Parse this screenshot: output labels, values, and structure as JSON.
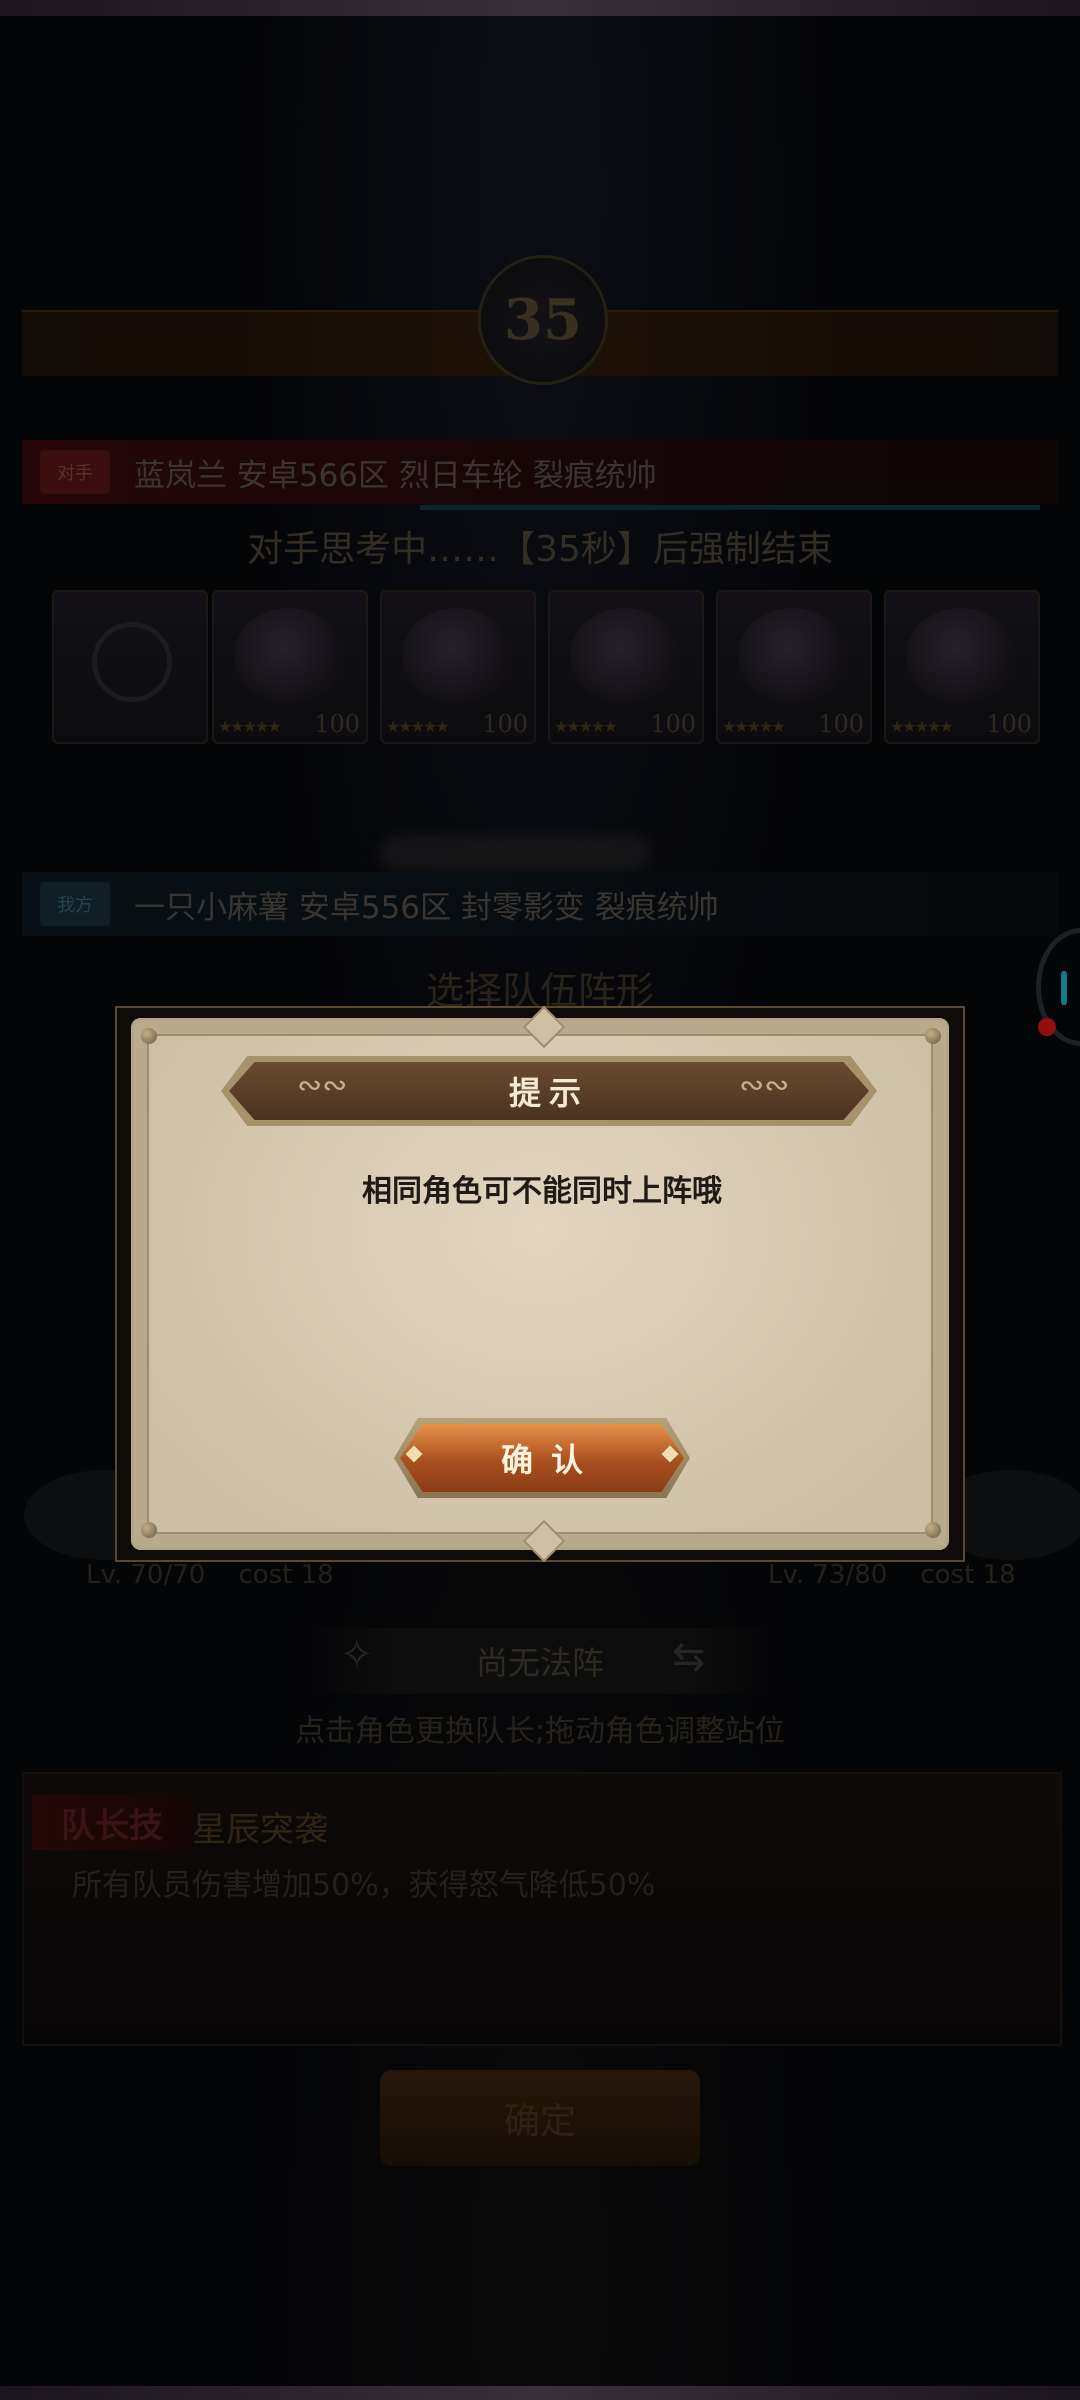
{
  "round": {
    "number": "35"
  },
  "opponent": {
    "tag": "对手",
    "name_line": "蓝岚兰  安卓566区  烈日车轮  裂痕统帅"
  },
  "countdown_text": "对手思考中……【35秒】后强制结束",
  "cards": [
    {
      "level": "",
      "empty": true
    },
    {
      "level": "100"
    },
    {
      "level": "100"
    },
    {
      "level": "100"
    },
    {
      "level": "100"
    },
    {
      "level": "100"
    }
  ],
  "me": {
    "tag": "我方",
    "name_line": "一只小麻薯  安卓556区  封零影变  裂痕统帅"
  },
  "format_title": "选择队伍阵形",
  "left_level": {
    "lv": "Lv. 70/70",
    "cost": "cost 18"
  },
  "right_level": {
    "lv": "Lv. 73/80",
    "cost": "cost 18"
  },
  "formation": {
    "label": "尚无法阵"
  },
  "hint": "点击角色更换队长;拖动角色调整站位",
  "captain_skill": {
    "tag": "队长技",
    "name": "星辰突袭",
    "description": "所有队员伤害增加50%，获得怒气降低50%"
  },
  "confirm_background": "确定",
  "dialog": {
    "title": "提示",
    "message": "相同角色可不能同时上阵哦",
    "button": "确认"
  }
}
